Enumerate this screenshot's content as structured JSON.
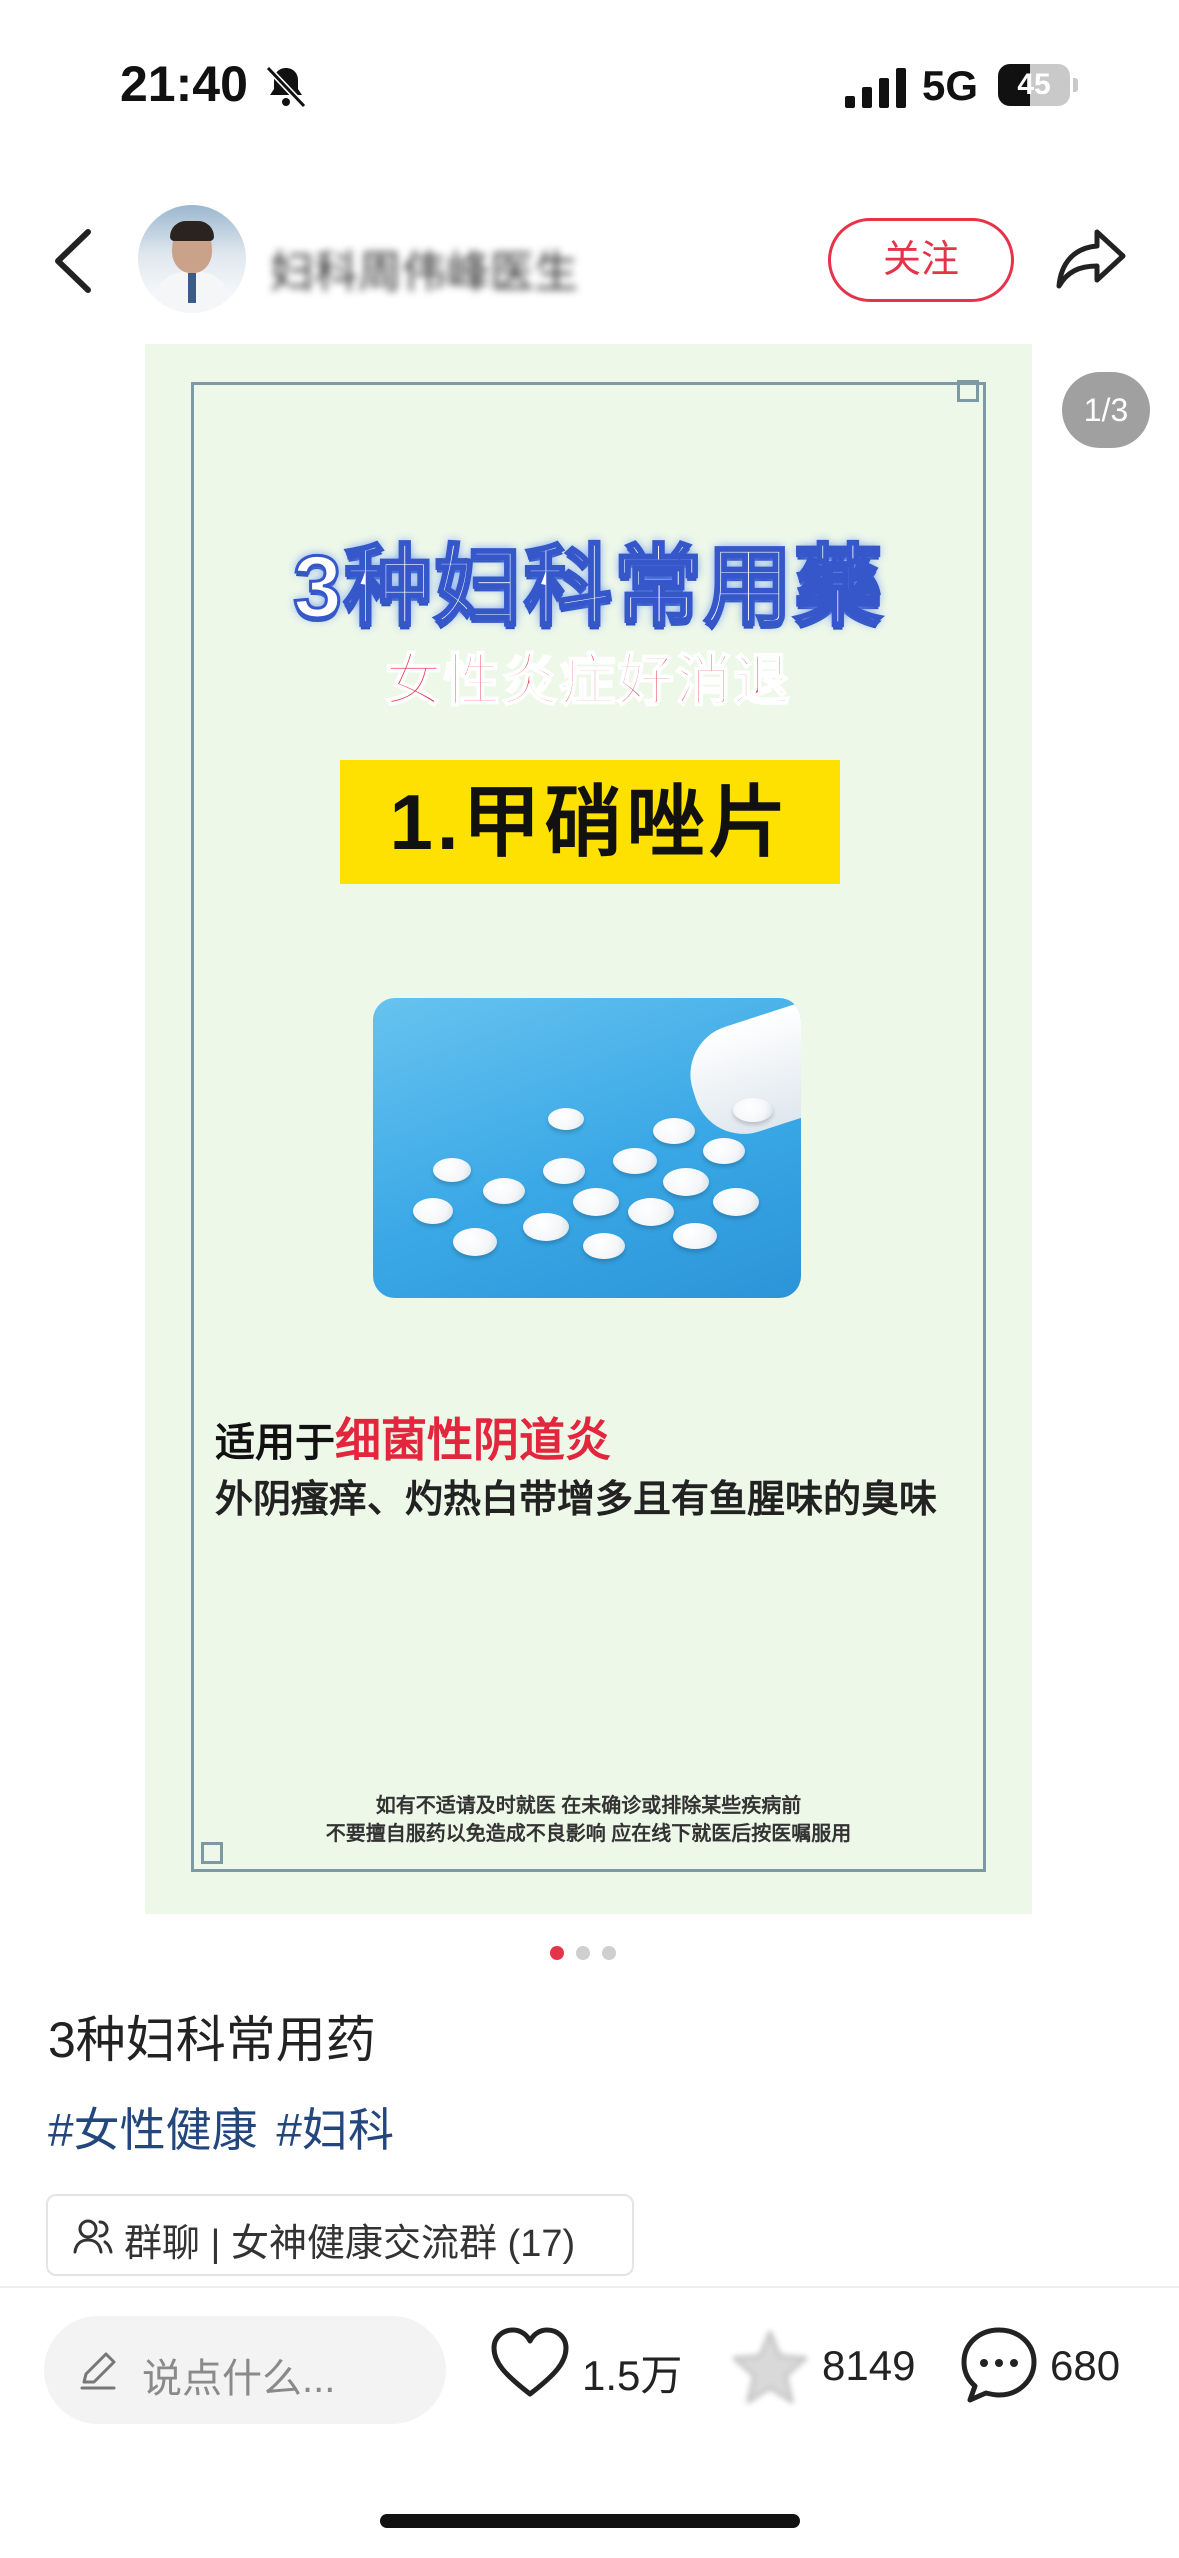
{
  "status_bar": {
    "time": "21:40",
    "network": "5G",
    "battery": "45",
    "battery_level": 0.45
  },
  "header": {
    "author_name": "妇科周伟峰医生",
    "follow_label": "关注"
  },
  "post_image": {
    "page_indicator": "1/3",
    "title": "3种妇科常用藥",
    "subtitle": "女性炎症好消退",
    "drug_label": "1.甲硝唑片",
    "usage_prefix": "适用于",
    "usage_highlight": "细菌性阴道炎",
    "symptoms": "外阴瘙痒、灼热白带增多且有鱼腥味的臭味",
    "disclaimer_line1": "如有不适请及时就医 在未确诊或排除某些疾病前",
    "disclaimer_line2": "不要擅自服药以免造成不良影响 应在线下就医后按医嘱服用"
  },
  "post": {
    "title": "3种妇科常用药",
    "tags": [
      "#女性健康",
      "#妇科"
    ],
    "group_label": "群聊 | 女神健康交流群 (17)"
  },
  "bottom_bar": {
    "comment_placeholder": "说点什么...",
    "like_count": "1.5万",
    "collect_count": "8149",
    "comment_count": "680"
  }
}
